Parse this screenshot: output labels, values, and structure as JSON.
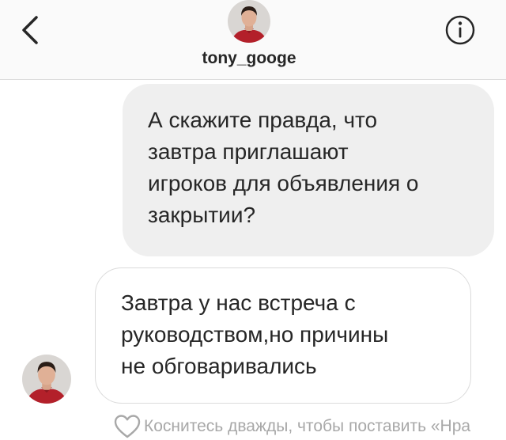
{
  "header": {
    "username": "tony_googe",
    "back_icon": "chevron-left-icon",
    "info_icon": "info-icon"
  },
  "messages": [
    {
      "direction": "outgoing",
      "text": "А скажите правда, что\nзавтра приглашают\nигроков для объявления о\nзакрытии?"
    },
    {
      "direction": "incoming",
      "text": "Завтра у нас встреча с\nруководством,но причины\nне обговаривались"
    }
  ],
  "like_hint": {
    "icon": "heart-outline-icon",
    "text": "Коснитесь дважды, чтобы поставить «Нра"
  },
  "colors": {
    "header_bg": "#fafafa",
    "outgoing_bubble": "#efefef",
    "incoming_border": "#dbdbdb",
    "text": "#262626",
    "hint_text": "#a8a8a8"
  }
}
